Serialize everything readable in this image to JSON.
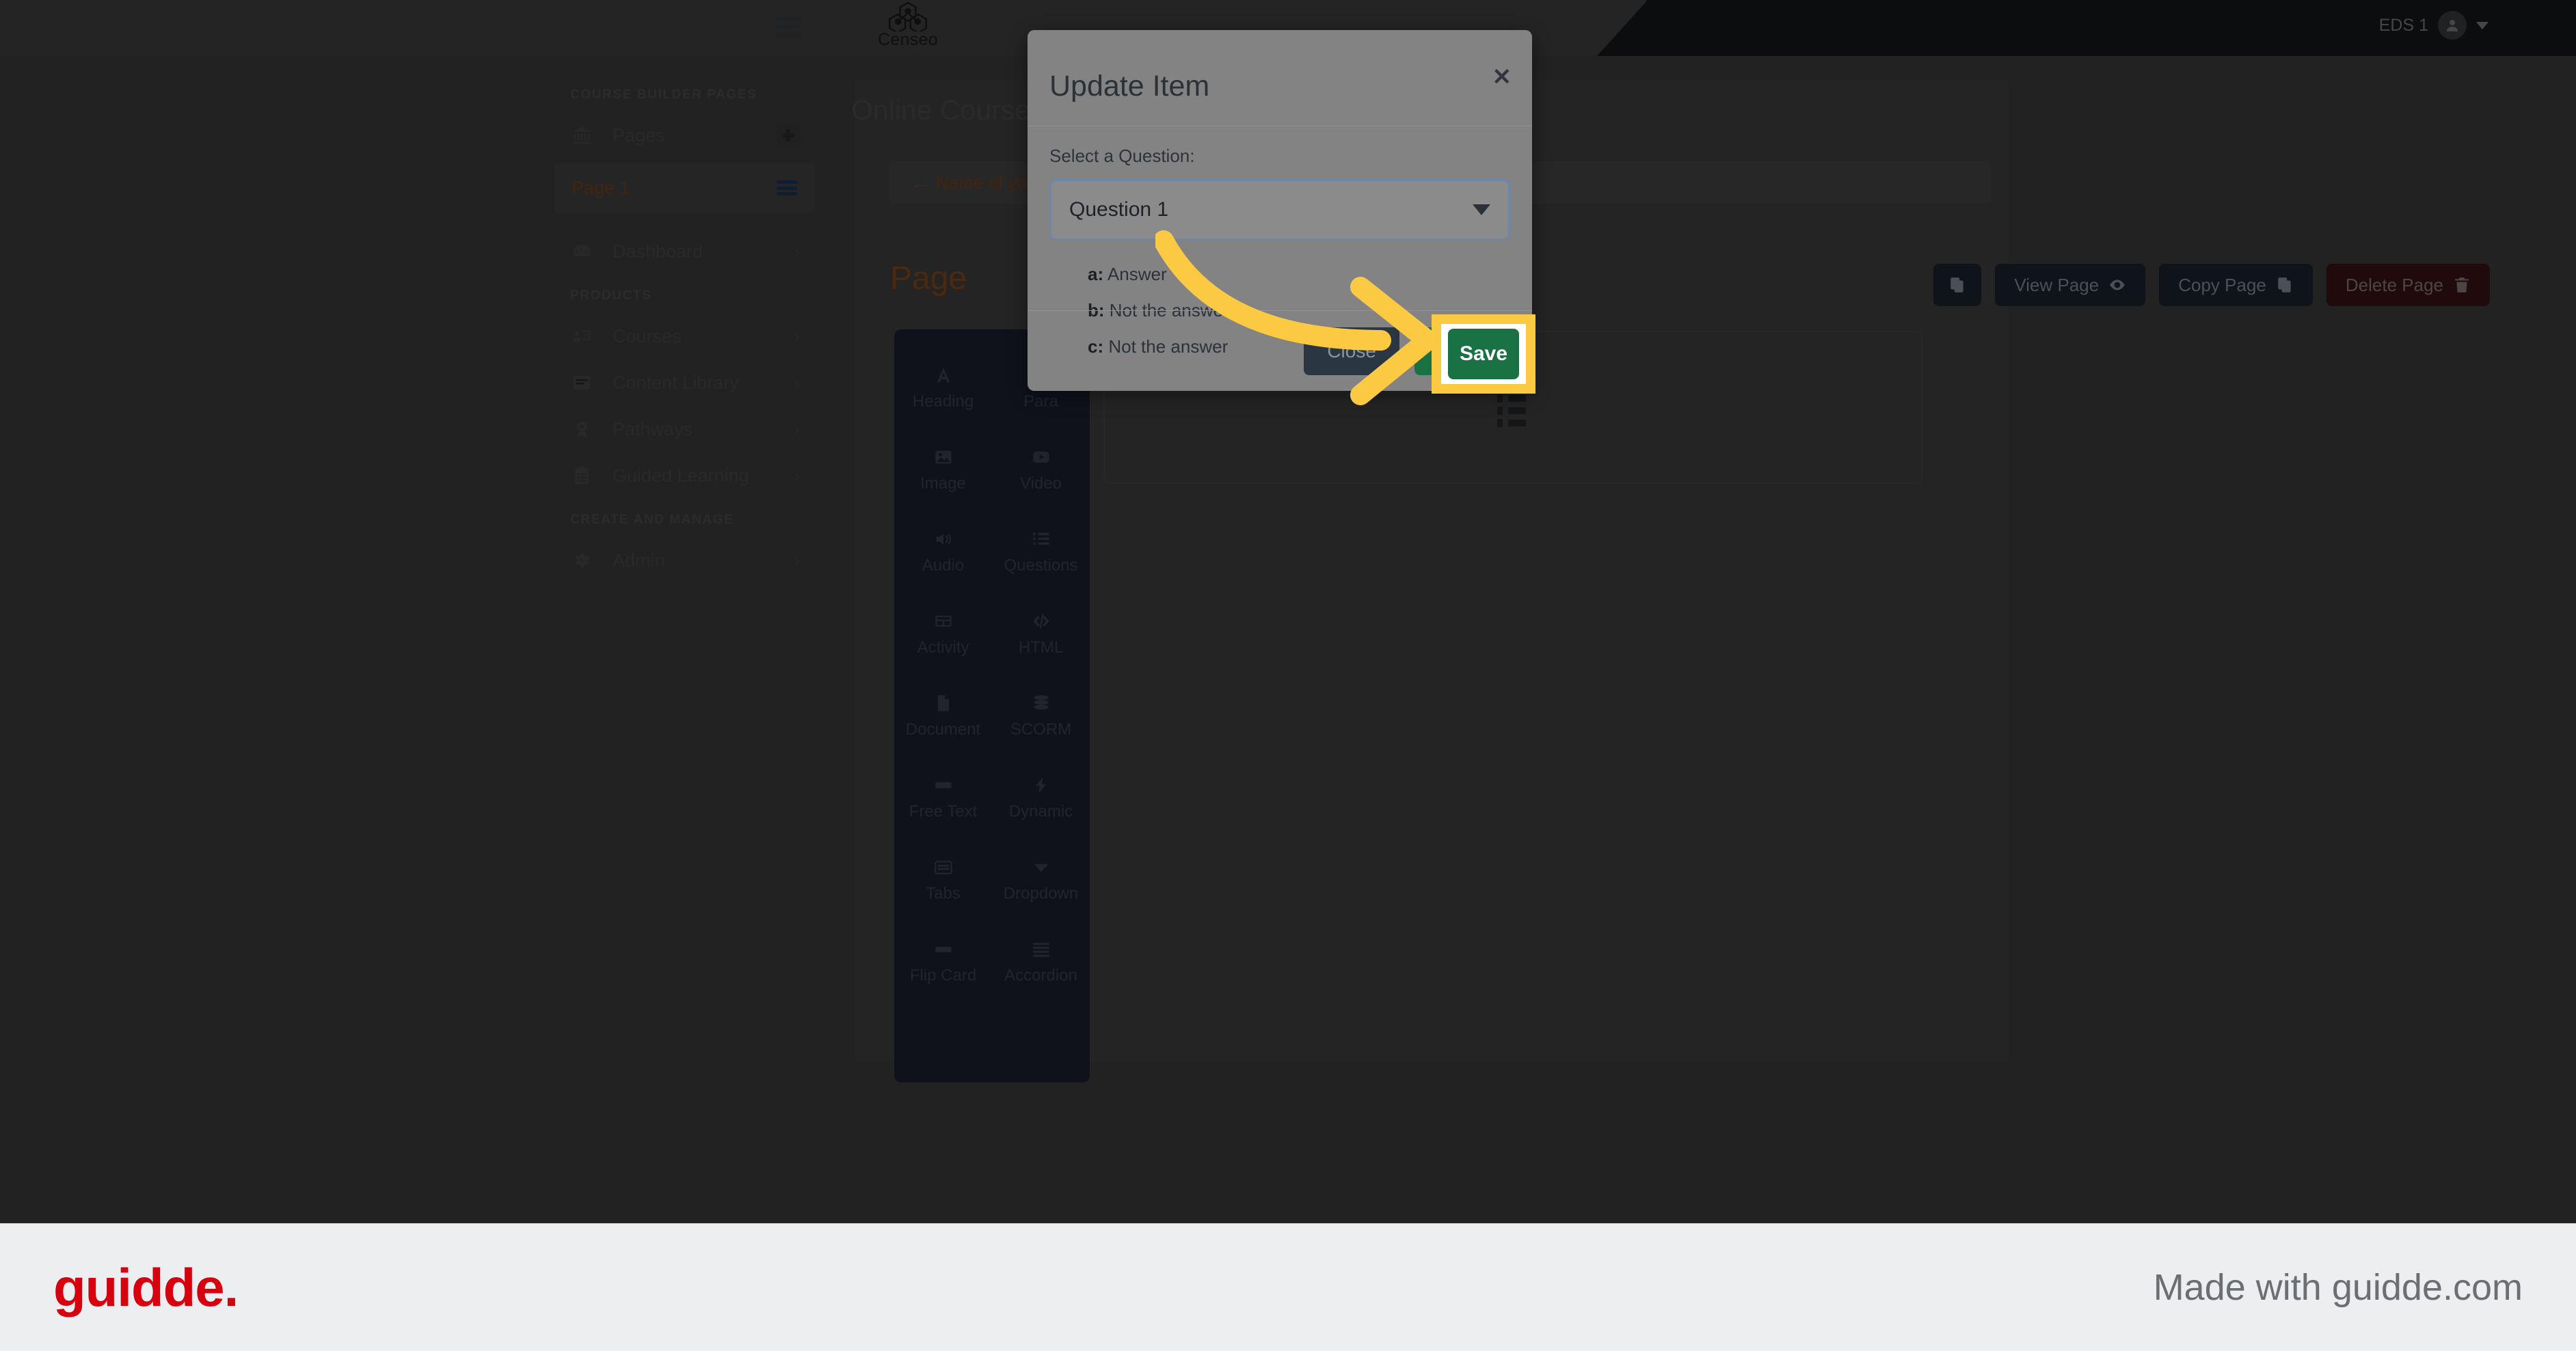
{
  "topbar": {
    "menu_icon": "hamburger-icon",
    "brand_name": "Censeo",
    "brand_mark": "molecule-hexagon-logo",
    "user_name": "EDS 1",
    "avatar_icon": "user-avatar-icon",
    "caret_icon": "chevron-down-icon"
  },
  "sidebar": {
    "sections": [
      {
        "label": "COURSE BUILDER PAGES",
        "items": [
          {
            "label": "Pages",
            "icon": "bank-columns-icon",
            "trailing": "plus-badge"
          }
        ],
        "page_item": {
          "label": "Page 1",
          "trailing_icon": "list-lines-icon"
        }
      },
      {
        "label": "",
        "items": [
          {
            "label": "Dashboard",
            "icon": "gauge-icon",
            "trailing": "chevron-right"
          }
        ]
      },
      {
        "label": "PRODUCTS",
        "items": [
          {
            "label": "Courses",
            "icon": "presentation-person-icon",
            "trailing": "chevron-right"
          },
          {
            "label": "Content Library",
            "icon": "book-icon",
            "trailing": "chevron-right"
          },
          {
            "label": "Pathways",
            "icon": "award-ribbon-icon",
            "trailing": "chevron-right"
          },
          {
            "label": "Guided Learning",
            "icon": "clipboard-list-icon",
            "trailing": "chevron-right"
          }
        ]
      },
      {
        "label": "CREATE AND MANAGE",
        "items": [
          {
            "label": "Admin",
            "icon": "gear-icon",
            "trailing": "chevron-right"
          }
        ]
      }
    ]
  },
  "main": {
    "page_title": "Online Course Builder",
    "course_name_field": "Name of your course",
    "back_arrow": "←",
    "page_heading": "Page",
    "buttons": [
      {
        "label": "",
        "icon": "copy-icon",
        "style": "dark"
      },
      {
        "label": "View Page",
        "icon": "eye-icon",
        "style": "dark"
      },
      {
        "label": "Copy Page",
        "icon": "copy-icon",
        "style": "dark"
      },
      {
        "label": "Delete Page",
        "icon": "trash-icon",
        "style": "danger"
      }
    ],
    "palette": [
      {
        "label": "Heading",
        "icon": "letter-a-icon"
      },
      {
        "label": "Para",
        "icon": "paragraph-icon"
      },
      {
        "label": "Image",
        "icon": "image-icon"
      },
      {
        "label": "Video",
        "icon": "video-icon"
      },
      {
        "label": "Audio",
        "icon": "speaker-icon"
      },
      {
        "label": "Questions",
        "icon": "list-bullets-icon"
      },
      {
        "label": "Activity",
        "icon": "table-icon"
      },
      {
        "label": "HTML",
        "icon": "code-brackets-icon"
      },
      {
        "label": "Document",
        "icon": "file-icon"
      },
      {
        "label": "SCORM",
        "icon": "database-icon"
      },
      {
        "label": "Free Text",
        "icon": "rectangle-icon"
      },
      {
        "label": "Dynamic",
        "icon": "lightning-bolt-icon"
      },
      {
        "label": "Tabs",
        "icon": "tabs-folder-icon"
      },
      {
        "label": "Dropdown",
        "icon": "triangle-down-icon"
      },
      {
        "label": "Flip Card",
        "icon": "card-icon"
      },
      {
        "label": "Accordion",
        "icon": "stacked-lines-icon"
      }
    ],
    "card_icon": "questions-list-icon"
  },
  "modal": {
    "title": "Update Item",
    "close_icon": "close-x-icon",
    "field_label": "Select a Question:",
    "select_value": "Question 1",
    "select_chevron": "chevron-down-icon",
    "answers": [
      {
        "key": "a:",
        "text": "Answer"
      },
      {
        "key": "b:",
        "text": "Not the answer"
      },
      {
        "key": "c:",
        "text": "Not the answer"
      }
    ],
    "close_button": "Close",
    "save_button": "Save"
  },
  "annotation": {
    "highlight_label": "Save",
    "highlight_border_color": "#fcc943",
    "arrow_color": "#fcc943"
  },
  "footer": {
    "logo_text": "guidde.",
    "logo_color": "#d6000f",
    "made_with": "Made with guidde.com"
  }
}
